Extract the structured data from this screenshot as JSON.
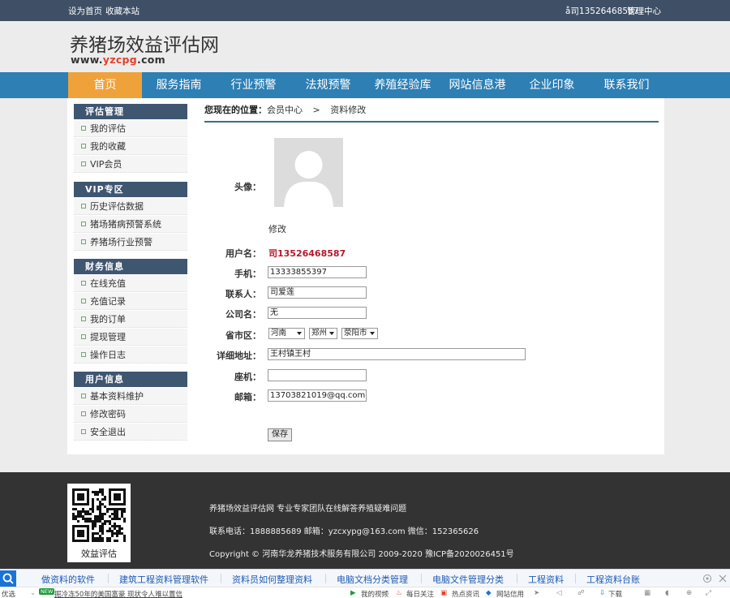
{
  "topbar": {
    "set_home": "设为首页",
    "bookmark": "收藏本站",
    "user": "å司13526468587",
    "admin": "管理中心"
  },
  "header": {
    "site_name": "养猪场效益评估网",
    "url_prefix": "www.",
    "url_highlight": "yzcpg",
    "url_suffix": ".com"
  },
  "nav": [
    "首页",
    "服务指南",
    "行业预警",
    "法规预警",
    "养殖经验库",
    "网站信息港",
    "企业印象",
    "联系我们"
  ],
  "sidebar": [
    {
      "title": "评估管理",
      "items": [
        "我的评估",
        "我的收藏",
        "VIP会员"
      ]
    },
    {
      "title": "VIP专区",
      "items": [
        "历史评估数据",
        "猪场猪病预警系统",
        "养猪场行业预警"
      ]
    },
    {
      "title": "财务信息",
      "items": [
        "在线充值",
        "充值记录",
        "我的订单",
        "提现管理",
        "操作日志"
      ]
    },
    {
      "title": "用户信息",
      "items": [
        "基本资料维护",
        "修改密码",
        "安全退出"
      ]
    }
  ],
  "breadcrumb": {
    "label": "您现在的位置：",
    "parent": "会员中心",
    "separator": ">",
    "current": "资料修改"
  },
  "form": {
    "avatar_label": "头像：",
    "edit_avatar": "修改",
    "username_label": "用户名：",
    "username": "司13526468587",
    "phone_label": "手机：",
    "phone": "13333855397",
    "contact_label": "联系人：",
    "contact": "司爱莲",
    "company_label": "公司名：",
    "company": "无",
    "region_label": "省市区：",
    "province": "河南",
    "city": "郑州",
    "district": "荥阳市",
    "address_label": "详细地址：",
    "address": "王村镇王村",
    "landline_label": "座机：",
    "landline": "",
    "email_label": "邮箱：",
    "email": "13703821019@qq.com",
    "save": "保存"
  },
  "footer": {
    "qr_caption": "效益评估",
    "line1": "养猪场效益评估网 专业专家团队在线解答养殖疑难问题",
    "line2": "联系电话：1888885689 邮箱：yzcxypg@163.com 微信：152365626",
    "line3": "Copyright © 河南华龙养猪技术服务有限公司 2009-2020 豫ICP备2020026451号"
  },
  "browser_bar": {
    "links": [
      "做资料的软件",
      "建筑工程资料管理软件",
      "资料员如何整理资料",
      "电脑文档分类管理",
      "电脑文件管理分类",
      "工程资料",
      "工程资料台账"
    ]
  },
  "status_bar": {
    "left": "优选",
    "badge": "NEW",
    "news": "掘冷冻50年的美国富豪 现状令人难以置信",
    "items": [
      "我的视频",
      "每日关注",
      "热点资讯",
      "网站信用",
      "下载"
    ]
  },
  "colors": {
    "topbar": "#3e4f66",
    "nav": "#2d7fb4",
    "nav_active": "#f0a23a",
    "sidebar_title": "#3f5671",
    "username": "#b3192b",
    "footer": "#333333"
  }
}
